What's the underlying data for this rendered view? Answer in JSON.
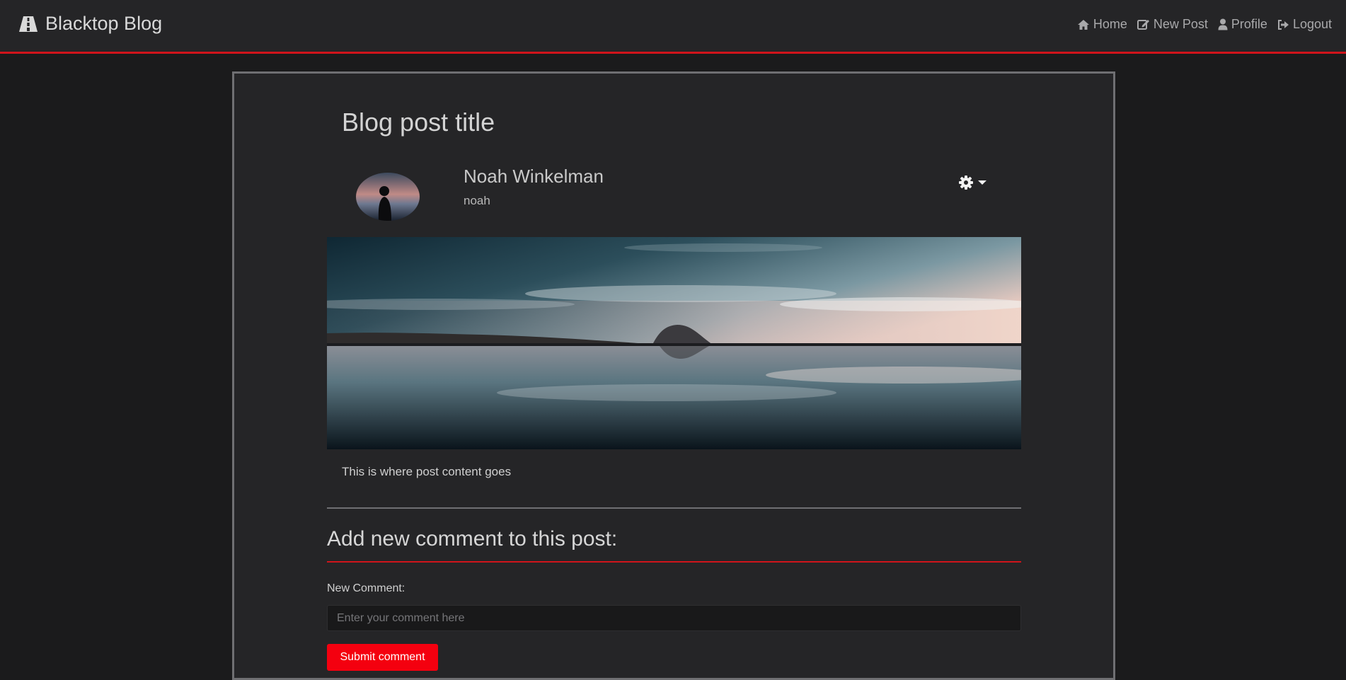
{
  "navbar": {
    "brand": "Blacktop Blog",
    "brand_icon": "road-icon",
    "links": [
      {
        "label": "Home",
        "icon": "home-icon"
      },
      {
        "label": "New Post",
        "icon": "edit-icon"
      },
      {
        "label": "Profile",
        "icon": "user-icon"
      },
      {
        "label": "Logout",
        "icon": "sign-out-icon"
      }
    ],
    "accent": "#d0141b"
  },
  "post": {
    "title": "Blog post title",
    "author": {
      "name": "Noah Winkelman",
      "username": "noah"
    },
    "content": "This is where post content goes"
  },
  "comment_form": {
    "heading": "Add new comment to this post:",
    "label": "New Comment:",
    "placeholder": "Enter your comment here",
    "submit_label": "Submit comment",
    "button_color": "#f4000f"
  }
}
